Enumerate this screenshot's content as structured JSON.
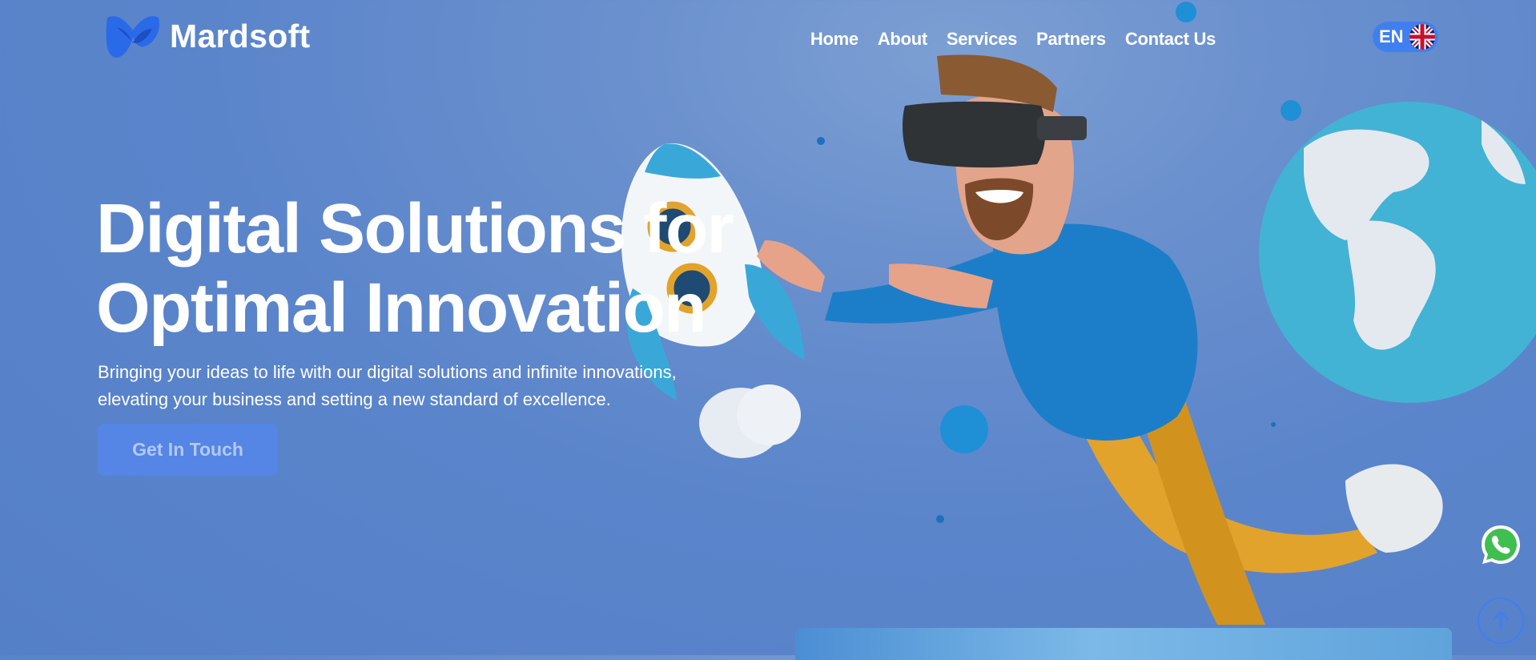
{
  "brand": {
    "name": "Mardsoft",
    "logo_icon": "mardsoft-logo-icon"
  },
  "nav": {
    "items": [
      {
        "label": "Home"
      },
      {
        "label": "About"
      },
      {
        "label": "Services"
      },
      {
        "label": "Partners"
      },
      {
        "label": "Contact Us"
      }
    ]
  },
  "language": {
    "label": "EN",
    "flag_icon": "uk-flag-icon"
  },
  "hero": {
    "title_line1": "Digital Solutions for",
    "title_line2": "Optimal Innovation",
    "subtitle_line1": "Bringing your ideas to life with our digital solutions and infinite innovations,",
    "subtitle_line2": "elevating your business and setting a new standard of excellence.",
    "cta_label": "Get In Touch"
  },
  "floating": {
    "whatsapp_icon": "whatsapp-icon",
    "scroll_top_icon": "arrow-up-icon"
  },
  "colors": {
    "accent": "#3f7ff0",
    "background": "#5b85cb",
    "cta": "#5585e5"
  }
}
